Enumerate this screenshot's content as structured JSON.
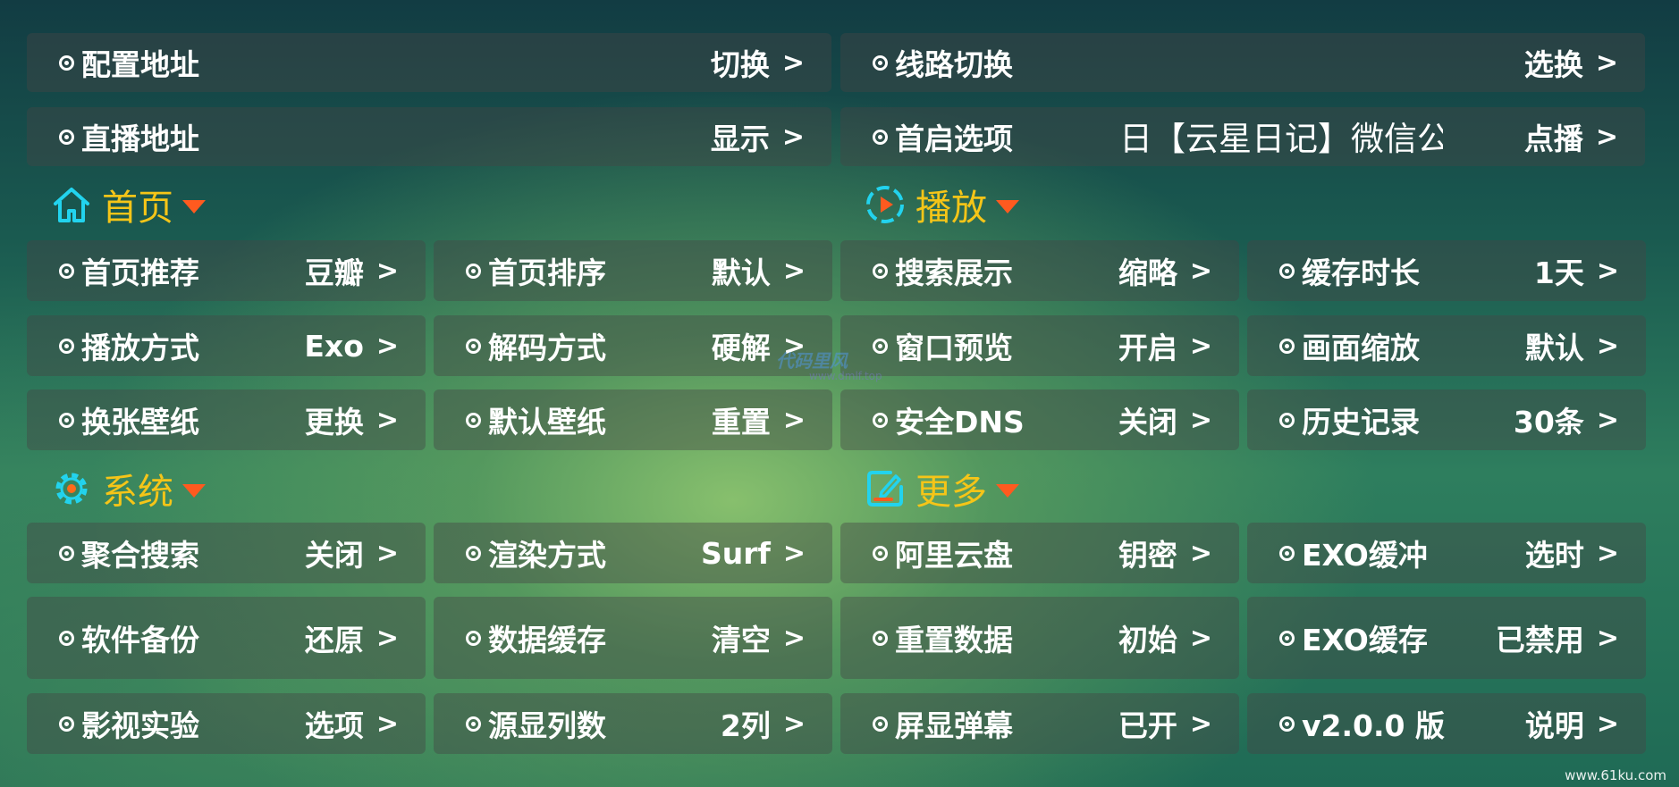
{
  "top": [
    {
      "label": "配置地址",
      "value": "切换",
      "arrow": ">"
    },
    {
      "label": "线路切换",
      "value": "选换",
      "arrow": ">"
    },
    {
      "label": "直播地址",
      "value": "显示",
      "arrow": ">"
    },
    {
      "label": "首启选项",
      "value": "点播",
      "arrow": ">"
    }
  ],
  "marquee_text": "日【云星日记】微信公",
  "sections": {
    "home": {
      "title": "首页",
      "icon": "home-icon"
    },
    "play": {
      "title": "播放",
      "icon": "play-circle-icon"
    },
    "system": {
      "title": "系统",
      "icon": "gear-icon"
    },
    "more": {
      "title": "更多",
      "icon": "edit-note-icon"
    }
  },
  "grid1": [
    [
      {
        "label": "首页推荐",
        "value": "豆瓣"
      },
      {
        "label": "首页排序",
        "value": "默认"
      },
      {
        "label": "搜索展示",
        "value": "缩略"
      },
      {
        "label": "缓存时长",
        "value": "1天"
      }
    ],
    [
      {
        "label": "播放方式",
        "value": "Exo"
      },
      {
        "label": "解码方式",
        "value": "硬解"
      },
      {
        "label": "窗口预览",
        "value": "开启"
      },
      {
        "label": "画面缩放",
        "value": "默认"
      }
    ],
    [
      {
        "label": "换张壁纸",
        "value": "更换"
      },
      {
        "label": "默认壁纸",
        "value": "重置"
      },
      {
        "label": "安全DNS",
        "value": "关闭"
      },
      {
        "label": "历史记录",
        "value": "30条"
      }
    ]
  ],
  "grid2": [
    [
      {
        "label": "聚合搜索",
        "value": "关闭"
      },
      {
        "label": "渲染方式",
        "value": "Surf"
      },
      {
        "label": "阿里云盘",
        "value": "钥密"
      },
      {
        "label": "EXO缓冲",
        "value": "选时"
      }
    ],
    [
      {
        "label": "软件备份",
        "value": "还原"
      },
      {
        "label": "数据缓存",
        "value": "清空"
      },
      {
        "label": "重置数据",
        "value": "初始"
      },
      {
        "label": "EXO缓存",
        "value": "已禁用"
      }
    ],
    [
      {
        "label": "影视实验",
        "value": "选项"
      },
      {
        "label": "源显列数",
        "value": "2列"
      },
      {
        "label": "屏显弹幕",
        "value": "已开"
      },
      {
        "label": "v2.0.0 版",
        "value": "说明"
      }
    ]
  ],
  "arrow_glyph": ">",
  "watermark": {
    "main": "代码里风",
    "sub": "www.dmlf.top",
    "corner": "www.61ku.com"
  },
  "colors": {
    "section_title": "#f5c518",
    "triangle": "#ff5a1f",
    "icon_cyan": "#22d3ee",
    "gear_orange": "#ff6a1a"
  }
}
